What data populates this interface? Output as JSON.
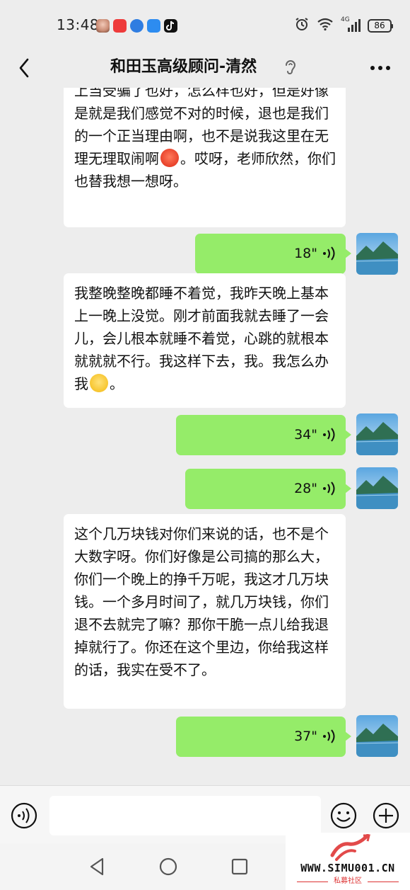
{
  "status_bar": {
    "time": "13:48",
    "network": "4G",
    "battery": "86",
    "left_icons": [
      "app-avatar-icon",
      "app-red-icon",
      "app-blue-icon",
      "app-cloud-icon",
      "tiktok-icon"
    ],
    "right_icons": [
      "alarm-icon",
      "wifi-icon",
      "signal-icon",
      "battery-icon"
    ]
  },
  "header": {
    "title": "和田玉高级顾问-清然",
    "back_icon": "chevron-left-icon",
    "ear_icon": "earpiece-icon",
    "more_icon": "more-dots-icon"
  },
  "messages": [
    {
      "type": "text",
      "side": "left",
      "segments": [
        {
          "t": "text",
          "v": "上当受骗了也好，怎么样也好，但是好像是就是我们感觉不对的时候，退也是我们的一个正当理由啊，也不是说我这里在无理无理取闹啊"
        },
        {
          "t": "emoji",
          "v": "angry-face-emoji"
        },
        {
          "t": "text",
          "v": "。哎呀，老师欣然，你们也替我想一想呀。"
        }
      ]
    },
    {
      "type": "voice",
      "side": "right",
      "duration": "18\""
    },
    {
      "type": "text",
      "side": "left",
      "segments": [
        {
          "t": "text",
          "v": "我整晚整晚都睡不着觉，我昨天晚上基本上一晚上没觉。刚才前面我就去睡了一会儿，会儿根本就睡不着觉，心跳的就根本就就就不行。我这样下去，我。我怎么办我"
        },
        {
          "t": "emoji",
          "v": "crying-face-emoji"
        },
        {
          "t": "text",
          "v": "。"
        }
      ]
    },
    {
      "type": "voice",
      "side": "right",
      "duration": "34\""
    },
    {
      "type": "voice",
      "side": "right",
      "duration": "28\""
    },
    {
      "type": "text",
      "side": "left",
      "segments": [
        {
          "t": "text",
          "v": "这个几万块钱对你们来说的话，也不是个大数字呀。你们好像是公司搞的那么大，你们一个晚上的挣千万呢，我这才几万块钱。一个多月时间了，就几万块钱，你们退不去就完了嘛？那你干脆一点儿给我退掉就行了。你还在这个里边，你给我这样的话，我实在受不了。"
        }
      ]
    },
    {
      "type": "voice",
      "side": "right",
      "duration": "37\""
    }
  ],
  "input_bar": {
    "voice_icon": "voice-mode-icon",
    "placeholder": "",
    "emoji_icon": "emoji-icon",
    "plus_icon": "plus-icon"
  },
  "nav_bar": {
    "icons": [
      "back-triangle-icon",
      "home-circle-icon",
      "recents-square-icon"
    ]
  },
  "watermark": {
    "url": "WWW.SIMU001.CN",
    "label": "私募社区"
  },
  "colors": {
    "background": "#ededed",
    "bubble_incoming": "#ffffff",
    "bubble_outgoing": "#95ec69",
    "watermark_red": "#dd3333"
  }
}
